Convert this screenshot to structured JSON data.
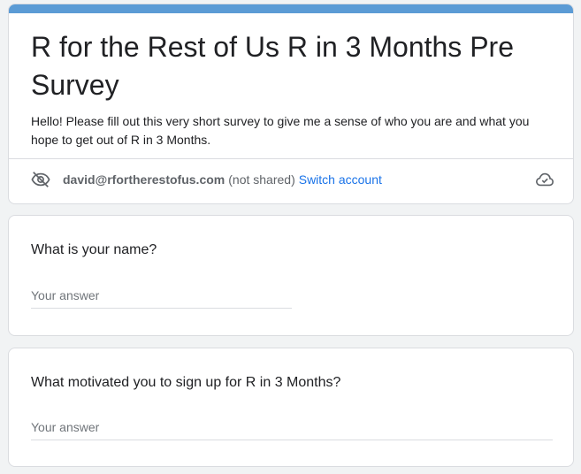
{
  "form": {
    "title": "R for the Rest of Us R in 3 Months Pre Survey",
    "description": "Hello! Please fill out this very short survey to give me a sense of who you are and what you hope to get out of R in 3 Months.",
    "accent_color": "#5b9bd5"
  },
  "account": {
    "visibility_icon": "eye-off-icon",
    "email": "david@rfortherestofus.com",
    "shared_status": "(not shared)",
    "switch_label": "Switch account",
    "save_status_icon": "cloud-saved-icon"
  },
  "questions": [
    {
      "title": "What is your name?",
      "answer_placeholder": "Your answer",
      "answer_value": ""
    },
    {
      "title": "What motivated you to sign up for R in 3 Months?",
      "answer_placeholder": "Your answer",
      "answer_value": ""
    }
  ]
}
